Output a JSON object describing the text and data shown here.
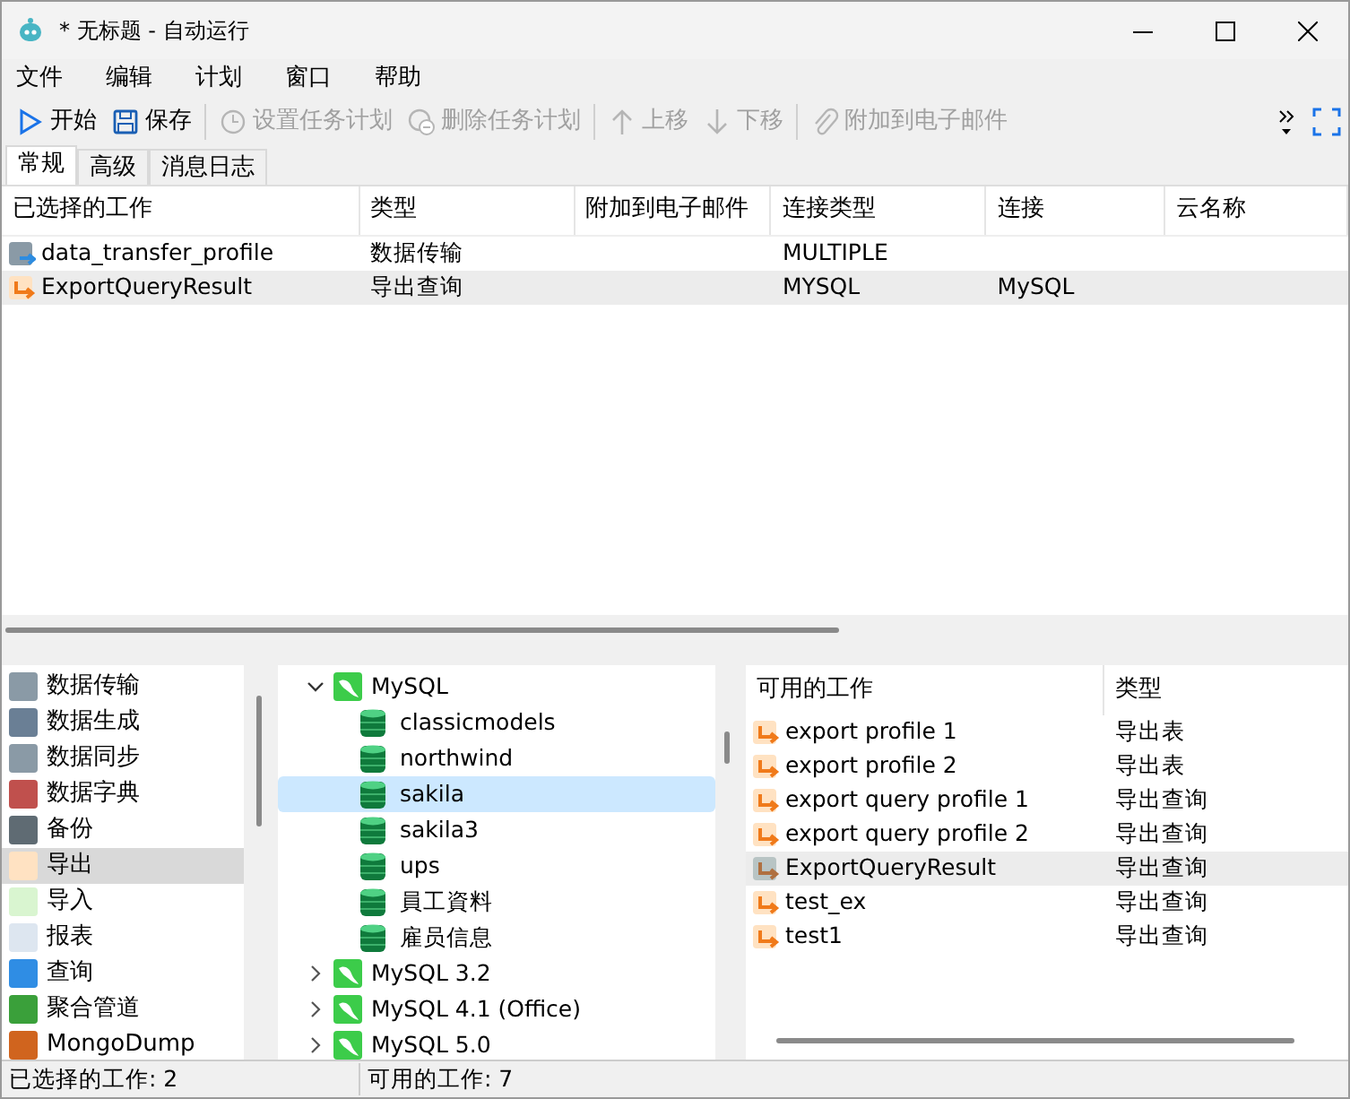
{
  "window": {
    "title": "* 无标题 - 自动运行"
  },
  "menu": [
    "文件",
    "编辑",
    "计划",
    "窗口",
    "帮助"
  ],
  "toolbar": [
    {
      "label": "开始",
      "disabled": false
    },
    {
      "label": "保存",
      "disabled": false
    },
    {
      "label": "设置任务计划",
      "disabled": true
    },
    {
      "label": "删除任务计划",
      "disabled": true
    },
    {
      "label": "上移",
      "disabled": true
    },
    {
      "label": "下移",
      "disabled": true
    },
    {
      "label": "附加到电子邮件",
      "disabled": true
    }
  ],
  "tabs": [
    {
      "label": "常规",
      "selected": true
    },
    {
      "label": "高级",
      "selected": false
    },
    {
      "label": "消息日志",
      "selected": false
    }
  ],
  "selected_jobs": {
    "columns": [
      "已选择的工作",
      "类型",
      "附加到电子邮件",
      "连接类型",
      "连接",
      "云名称"
    ],
    "rows": [
      {
        "kind": "transfer",
        "selected": false,
        "cells": [
          "data_transfer_profile",
          "数据传输",
          "",
          "MULTIPLE",
          "",
          ""
        ]
      },
      {
        "kind": "export",
        "selected": true,
        "cells": [
          "ExportQueryResult",
          "导出查询",
          "",
          "MYSQL",
          "MySQL",
          ""
        ]
      }
    ]
  },
  "categories": [
    {
      "label": "数据传输",
      "selected": false
    },
    {
      "label": "数据生成",
      "selected": false
    },
    {
      "label": "数据同步",
      "selected": false
    },
    {
      "label": "数据字典",
      "selected": false
    },
    {
      "label": "备份",
      "selected": false
    },
    {
      "label": "导出",
      "selected": true
    },
    {
      "label": "导入",
      "selected": false
    },
    {
      "label": "报表",
      "selected": false
    },
    {
      "label": "查询",
      "selected": false
    },
    {
      "label": "聚合管道",
      "selected": false
    },
    {
      "label": "MongoDump",
      "selected": false
    }
  ],
  "connections": [
    {
      "label": "MySQL",
      "expanded": true,
      "children": [
        {
          "label": "classicmodels",
          "selected": false
        },
        {
          "label": "northwind",
          "selected": false
        },
        {
          "label": "sakila",
          "selected": true
        },
        {
          "label": "sakila3",
          "selected": false
        },
        {
          "label": "ups",
          "selected": false
        },
        {
          "label": "員工資料",
          "selected": false
        },
        {
          "label": "雇员信息",
          "selected": false
        }
      ]
    },
    {
      "label": "MySQL 3.2",
      "expanded": false
    },
    {
      "label": "MySQL 4.1 (Office)",
      "expanded": false
    },
    {
      "label": "MySQL 5.0",
      "expanded": false
    }
  ],
  "available_jobs": {
    "columns": [
      "可用的工作",
      "类型"
    ],
    "rows": [
      {
        "selected": false,
        "cells": [
          "export profile 1",
          "导出表"
        ]
      },
      {
        "selected": false,
        "cells": [
          "export profile 2",
          "导出表"
        ]
      },
      {
        "selected": false,
        "cells": [
          "export query profile 1",
          "导出查询"
        ]
      },
      {
        "selected": false,
        "cells": [
          "export query profile 2",
          "导出查询"
        ]
      },
      {
        "selected": true,
        "cells": [
          "ExportQueryResult",
          "导出查询"
        ]
      },
      {
        "selected": false,
        "cells": [
          "test_ex",
          "导出查询"
        ]
      },
      {
        "selected": false,
        "cells": [
          "test1",
          "导出查询"
        ]
      }
    ]
  },
  "status_bar": [
    "已选择的工作: 2",
    "可用的工作: 7"
  ]
}
